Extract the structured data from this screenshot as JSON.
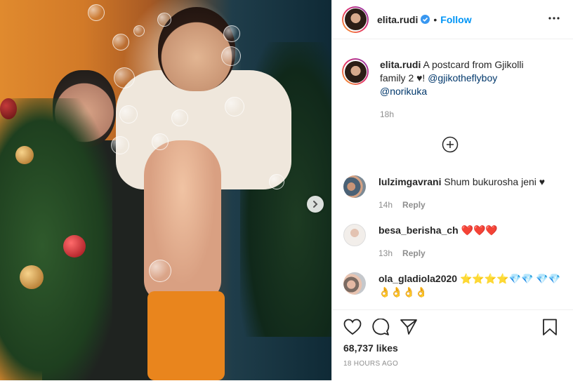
{
  "post": {
    "username": "elita.rudi",
    "follow_label": "Follow",
    "separator": "•",
    "caption_text": "A postcard from Gjikolli family 2 ♥! ",
    "mention_1": "@gjikotheflyboy",
    "mention_2": "@norikuka",
    "caption_time": "18h"
  },
  "comments": [
    {
      "username": "lulzimgavrani",
      "text": "Shum bukurosha jeni ♥",
      "time": "14h",
      "reply": "Reply"
    },
    {
      "username": "besa_berisha_ch",
      "text": "❤️❤️❤️",
      "time": "13h",
      "reply": "Reply"
    },
    {
      "username": "ola_gladiola2020",
      "text": "⭐⭐⭐⭐💎💎 💎💎👌👌👌👌",
      "time": "",
      "reply": ""
    }
  ],
  "footer": {
    "likes": "68,737 likes",
    "ago": "18 HOURS AGO"
  },
  "colors": {
    "link": "#0095f6",
    "mention": "#00376b",
    "muted": "#8e8e8e"
  },
  "icons": [
    "verified-icon",
    "more-options-icon",
    "add-comment-icon",
    "heart-icon",
    "comment-icon",
    "share-icon",
    "bookmark-icon",
    "chevron-right-icon"
  ]
}
